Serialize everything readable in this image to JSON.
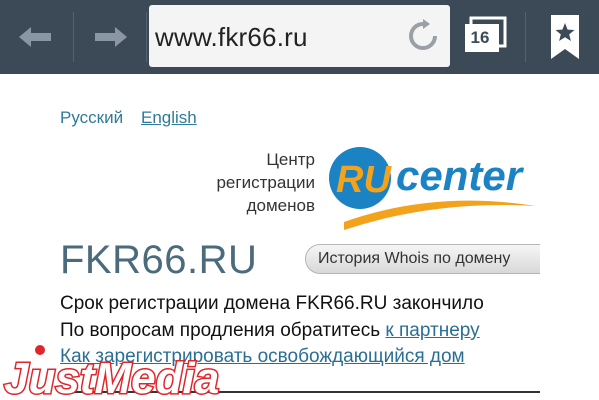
{
  "browser": {
    "url": "www.fkr66.ru",
    "tab_count": "16",
    "icons": {
      "back": "arrow-left-icon",
      "forward": "arrow-right-icon",
      "reload": "reload-icon",
      "tabs": "tabs-icon",
      "bookmark": "bookmark-star-icon"
    }
  },
  "page": {
    "languages": [
      "Русский",
      "English"
    ],
    "center_lines": [
      "Центр",
      "регистрации",
      "доменов"
    ],
    "logo_text": {
      "ru": "RU",
      "center": "center"
    },
    "domain": "FKR66.RU",
    "whois_button": "История Whois по домену",
    "line1": "Срок регистрации домена FKR66.RU закончило",
    "line2_text": "По вопросам продления обратитесь ",
    "line2_link": "к партнеру",
    "line3_link": "Как зарегистрировать освобождающийся дом"
  },
  "watermark": {
    "text": "JustMedia"
  },
  "colors": {
    "toolbar": "#3c4a58",
    "link": "#2a6e96",
    "logo_blue": "#1b82c4",
    "logo_orange": "#f3a21b",
    "watermark_red": "#e0262b"
  }
}
